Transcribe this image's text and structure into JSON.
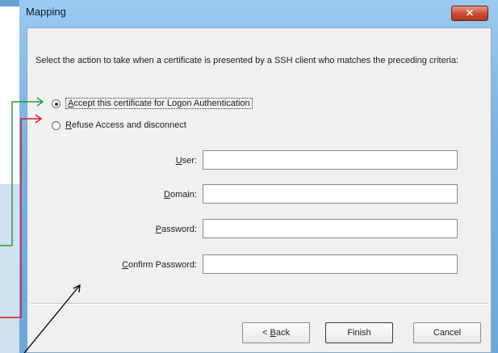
{
  "dialog": {
    "title": "Mapping",
    "close_glyph": "✕",
    "instruction": "Select the action to take when a certificate is presented by a SSH client who matches the preceding criteria:"
  },
  "options": [
    {
      "accel": "A",
      "rest": "ccept this certificate for Logon Authentication",
      "checked": true
    },
    {
      "accel": "R",
      "rest": "efuse Access and disconnect",
      "checked": false
    }
  ],
  "fields": [
    {
      "accel": "U",
      "rest": "ser:",
      "value": ""
    },
    {
      "accel": "D",
      "rest": "omain:",
      "value": ""
    },
    {
      "accel": "P",
      "rest": "assword:",
      "value": ""
    },
    {
      "pre": "",
      "accel": "C",
      "rest": "onfirm Password:",
      "value": ""
    }
  ],
  "buttons": {
    "back_prefix": "< ",
    "back_accel": "B",
    "back_rest": "ack",
    "finish": "Finish",
    "cancel": "Cancel"
  },
  "icons": {
    "close": "close-icon",
    "radio": "radio-icon"
  },
  "colors": {
    "annotation_green": "#22a03a",
    "annotation_red": "#d42020",
    "annotation_black": "#000000",
    "title_bar": "#79b2e3",
    "close_button": "#c94a35"
  }
}
